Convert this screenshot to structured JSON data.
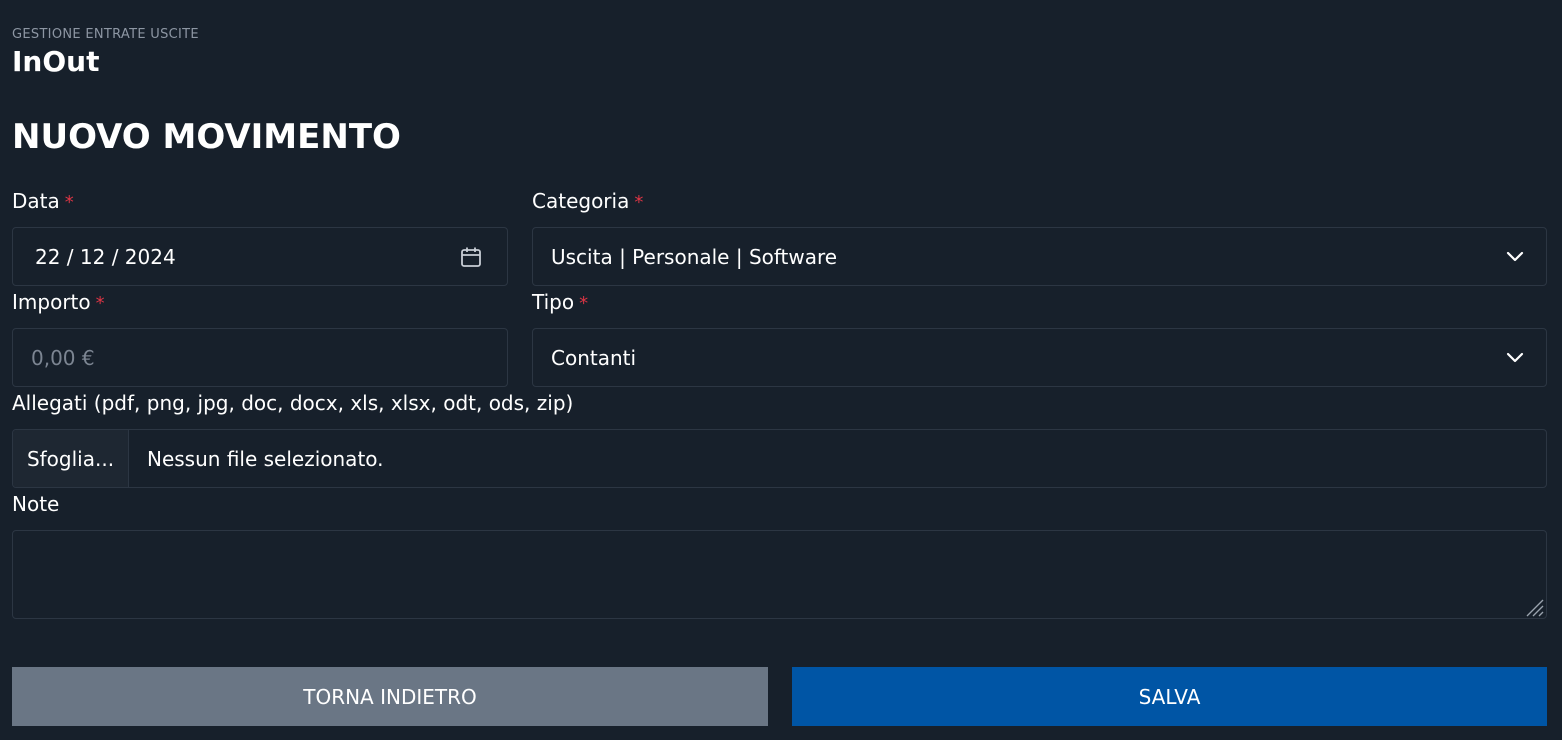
{
  "header": {
    "subtitle": "GESTIONE ENTRATE USCITE",
    "app_title": "InOut"
  },
  "form": {
    "title": "NUOVO MOVIMENTO",
    "required_marker": "*",
    "data": {
      "label": "Data",
      "value": "22 / 12 / 2024"
    },
    "categoria": {
      "label": "Categoria",
      "selected": "Uscita | Personale | Software"
    },
    "importo": {
      "label": "Importo",
      "placeholder": "0,00 €"
    },
    "tipo": {
      "label": "Tipo",
      "selected": "Contanti"
    },
    "allegati": {
      "label": "Allegati (pdf, png, jpg, doc, docx, xls, xlsx, odt, ods, zip)",
      "browse_label": "Sfoglia...",
      "status": "Nessun file selezionato."
    },
    "note": {
      "label": "Note",
      "value": ""
    }
  },
  "buttons": {
    "back_label": "TORNA INDIETRO",
    "save_label": "SALVA"
  },
  "colors": {
    "background": "#17202b",
    "required": "#dc3545",
    "back_button": "#6a7685",
    "save_button": "#0055a5"
  },
  "icons": {
    "calendar": "calendar-icon",
    "select_arrow": "chevron-down-icon"
  }
}
